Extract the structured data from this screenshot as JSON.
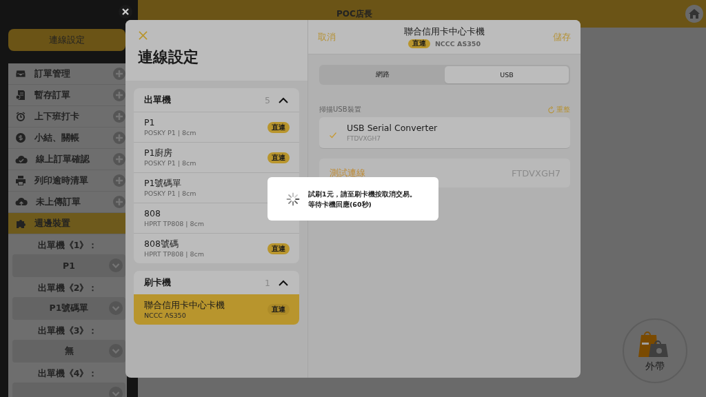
{
  "topbar": {
    "title": "POC店長"
  },
  "sidebar": {
    "connection_button": "連線設定",
    "menu": [
      {
        "label": "訂單管理",
        "expandable": true,
        "selected": false
      },
      {
        "label": "暫存訂單",
        "expandable": true,
        "selected": false
      },
      {
        "label": "上下班打卡",
        "expandable": true,
        "selected": false
      },
      {
        "label": "小結、關帳",
        "expandable": true,
        "selected": false
      },
      {
        "label": "線上訂單確認",
        "expandable": true,
        "selected": false
      },
      {
        "label": "列印逾時清單",
        "expandable": true,
        "selected": false
      },
      {
        "label": "未上傳訂單",
        "expandable": true,
        "selected": false
      },
      {
        "label": "週邊裝置",
        "expandable": false,
        "selected": true
      }
    ],
    "printers": [
      {
        "label": "出單機《1》：",
        "value": "P1"
      },
      {
        "label": "出單機《2》：",
        "value": "P1號碼單"
      },
      {
        "label": "出單機《3》：",
        "value": "無"
      },
      {
        "label": "出單機《4》："
      }
    ]
  },
  "modal": {
    "title": "連線設定",
    "groups": [
      {
        "name": "出單機",
        "count": "5",
        "expanded": true,
        "devices": [
          {
            "name": "P1",
            "model": "POSKY P1 | 8cm",
            "badge": "直連",
            "selected": false
          },
          {
            "name": "P1廚房",
            "model": "POSKY P1 | 8cm",
            "badge": "直連",
            "selected": false
          },
          {
            "name": "P1號碼單",
            "model": "POSKY P1 | 8cm",
            "selected": false
          },
          {
            "name": "808",
            "model": "HPRT TP808 | 8cm",
            "selected": false
          },
          {
            "name": "808號碼",
            "model": "HPRT TP808 | 8cm",
            "badge": "直連",
            "selected": false
          }
        ]
      },
      {
        "name": "刷卡機",
        "count": "1",
        "expanded": true,
        "devices": [
          {
            "name": "聯合信用卡中心卡機",
            "model": "NCCC AS350",
            "badge": "直連",
            "selected": true
          }
        ]
      }
    ],
    "detail": {
      "cancel": "取消",
      "title": "聯合信用卡中心卡機",
      "badge": "直連",
      "model": "NCCC AS350",
      "save": "儲存",
      "tabs": [
        {
          "label": "網路",
          "selected": false
        },
        {
          "label": "USB",
          "selected": true
        }
      ],
      "scan_label": "掃描USB裝置",
      "refresh": "重整",
      "usb_devices": [
        {
          "name": "USB Serial Converter",
          "serial": "FTDVXGH7",
          "checked": true
        }
      ],
      "test": {
        "label": "測試連線",
        "value": "FTDVXGH7"
      }
    }
  },
  "loading": {
    "lines": [
      "試刷1元，請至刷卡機按取消交易。",
      "等待卡機回應(60秒)"
    ]
  },
  "fab": {
    "label": "外帶"
  }
}
